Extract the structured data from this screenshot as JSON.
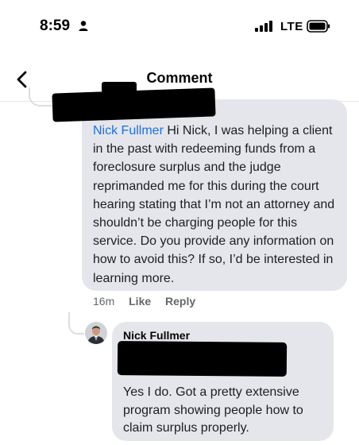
{
  "status_bar": {
    "time": "8:59",
    "carrier": "LTE",
    "icons": [
      "person-icon",
      "signal-icon",
      "battery-icon"
    ]
  },
  "header": {
    "title": "Comment",
    "back_icon": "chevron-left-icon"
  },
  "comment": {
    "mention": "Nick Fullmer",
    "text": " Hi Nick, I was helping a client in the past with redeeming funds from a foreclosure surplus and the judge reprimanded me for this during the court hearing stating that I’m not an attorney and shouldn’t be charging people for this service. Do you provide any information on how to avoid this? If so, I’d be interested in learning more.",
    "time_ago": "16m",
    "like_label": "Like",
    "reply_label": "Reply"
  },
  "reply": {
    "author": "Nick Fullmer",
    "text": "Yes I do.  Got a pretty extensive program showing people how to claim surplus properly."
  },
  "colors": {
    "mention": "#216fdb",
    "bubble": "#e4e6eb",
    "meta": "#65676b",
    "redaction": "#000000"
  }
}
